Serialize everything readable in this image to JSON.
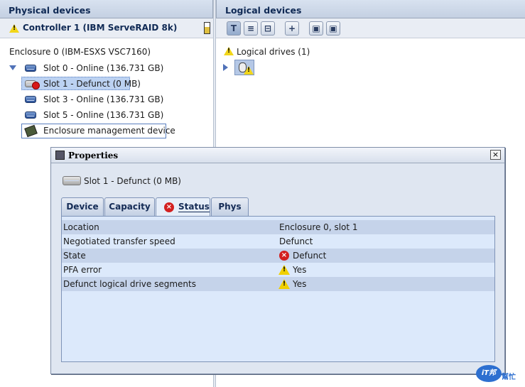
{
  "physical": {
    "header": "Physical devices",
    "controller": "Controller 1 (IBM ServeRAID 8k)",
    "tree": {
      "enclosure": "Enclosure 0 (IBM-ESXS VSC7160)",
      "slots": [
        {
          "label": "Slot 0 - Online (136.731 GB)"
        },
        {
          "label": "Slot 1 - Defunct (0 MB)"
        },
        {
          "label": "Slot 3 - Online (136.731 GB)"
        },
        {
          "label": "Slot 5 - Online (136.731 GB)"
        }
      ],
      "management": "Enclosure management device"
    }
  },
  "logical": {
    "header": "Logical devices",
    "toolbar": [
      "T",
      "≡",
      "⊟",
      "+",
      "▣",
      "▣"
    ],
    "drives_label": "Logical drives (1)"
  },
  "dialog": {
    "title": "Properties",
    "close": "×",
    "device_label": "Slot 1 - Defunct (0 MB)",
    "tabs": [
      "Device",
      "Capacity",
      "Status",
      "Phys"
    ],
    "active_tab": "Status",
    "rows": [
      {
        "label": "Location",
        "value": "Enclosure 0, slot 1",
        "icon": ""
      },
      {
        "label": "Negotiated transfer speed",
        "value": "Defunct",
        "icon": ""
      },
      {
        "label": "State",
        "value": "Defunct",
        "icon": "error-icon"
      },
      {
        "label": "PFA error",
        "value": "Yes",
        "icon": "warning-icon"
      },
      {
        "label": "Defunct logical drive segments",
        "value": "Yes",
        "icon": "warning-icon"
      }
    ]
  },
  "watermark": {
    "text": "iT邦",
    "sub": "幫忙"
  },
  "colors": {
    "error": "#d32020",
    "warning": "#f0d000",
    "selection": "#bcd2f2"
  }
}
